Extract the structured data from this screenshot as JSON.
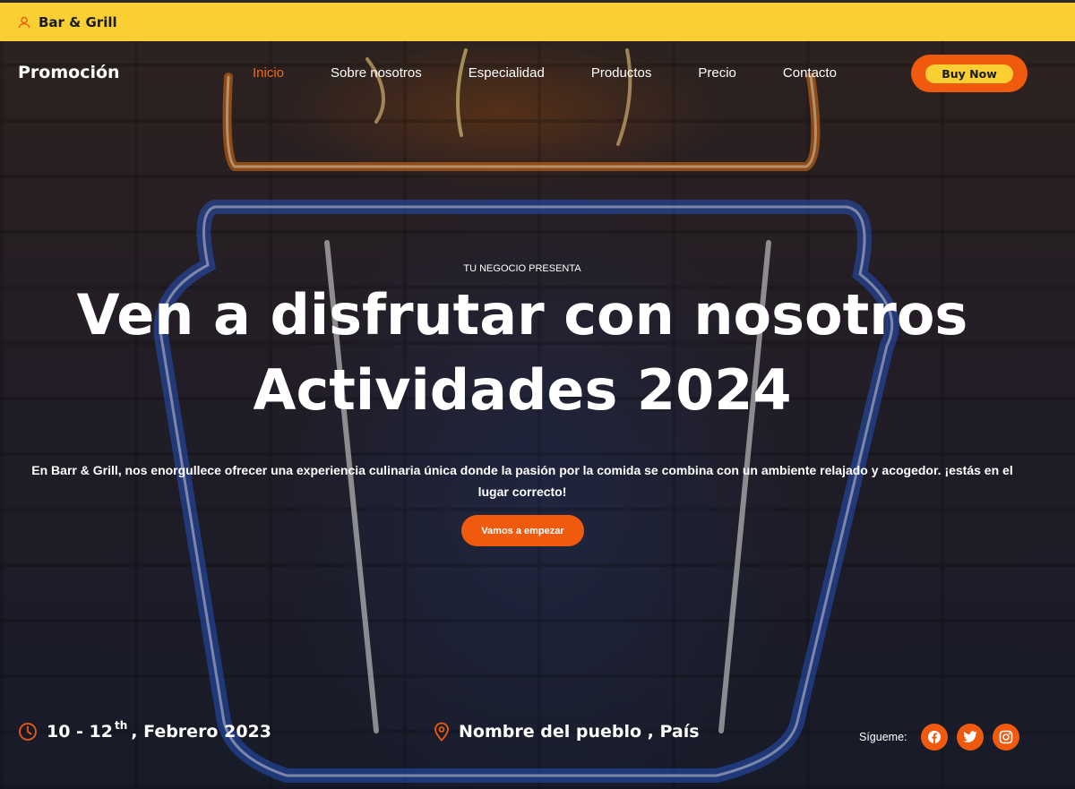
{
  "topbar": {
    "brand": "Bar & Grill",
    "icon": "user-icon"
  },
  "nav": {
    "logo": "Promoción",
    "items": [
      {
        "label": "Inicio",
        "active": true
      },
      {
        "label": "Sobre nosotros"
      },
      {
        "label": "Especialidad"
      },
      {
        "label": "Productos"
      },
      {
        "label": "Precio"
      },
      {
        "label": "Contacto"
      }
    ],
    "buy_label": "Buy Now"
  },
  "hero": {
    "eyebrow": "TU NEGOCIO PRESENTA",
    "headline_line1": "Ven a disfrutar con nosotros",
    "headline_line2": "Actividades 2024",
    "description": "En Barr & Grill, nos enorgullece ofrecer una experiencia culinaria única donde la pasión por la comida se combina con un ambiente relajado y acogedor. ¡estás en el lugar correcto!",
    "cta_label": "Vamos a empezar"
  },
  "event": {
    "date_prefix": "10 - 12",
    "date_sup": "th",
    "date_suffix": ", Febrero 2023",
    "location": "Nombre del pueblo , País",
    "date_icon": "clock-icon",
    "location_icon": "map-pin-icon"
  },
  "social": {
    "label": "Sígueme:",
    "icons": [
      "facebook-icon",
      "twitter-icon",
      "instagram-icon"
    ]
  },
  "colors": {
    "topbar": "#f9cf34",
    "accent": "#ef5a0f",
    "active_nav": "#f26a1b"
  }
}
